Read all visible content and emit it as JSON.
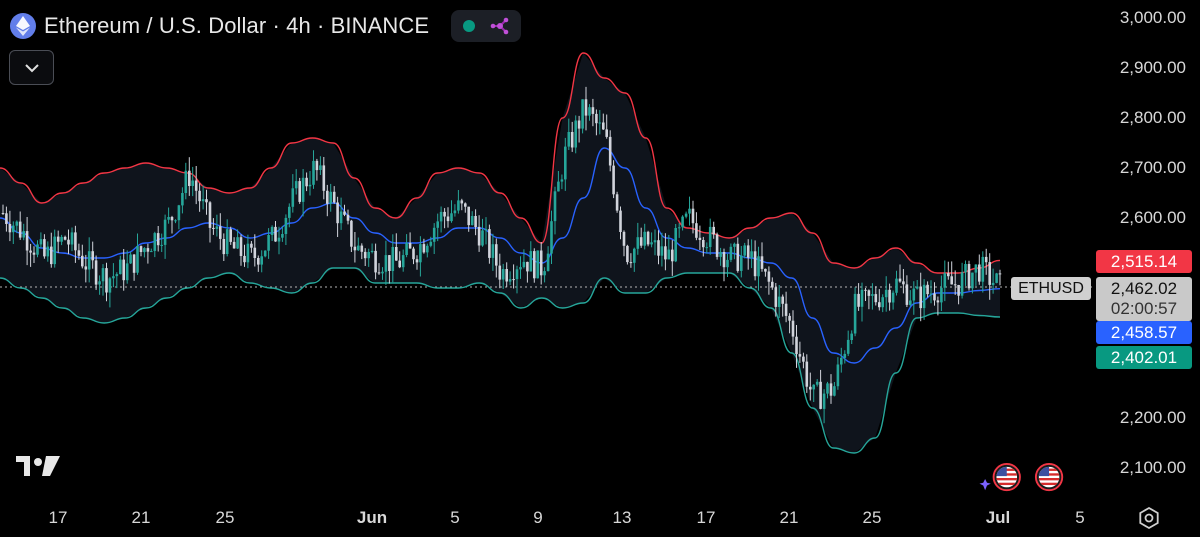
{
  "header": {
    "symbol_title": "Ethereum / U.S. Dollar · 4h · BINANCE",
    "logo_icon": "ethereum-icon",
    "status_icon": "market-open-dot",
    "indicator_icon": "ideas-network-icon",
    "collapse_icon": "chevron-down-icon"
  },
  "price_axis": {
    "labels": [
      "3,000.00",
      "2,900.00",
      "2,800.00",
      "2,700.00",
      "2,600.00",
      "2,200.00",
      "2,100.00"
    ]
  },
  "time_axis": {
    "labels": [
      "17",
      "21",
      "25",
      "Jun",
      "5",
      "9",
      "13",
      "17",
      "21",
      "25",
      "Jul",
      "5"
    ]
  },
  "price_tags": {
    "upper_band": "2,515.14",
    "last_price": "2,462.02",
    "countdown": "02:00:57",
    "basis": "2,458.57",
    "lower_band": "2,402.01",
    "symbol": "ETHUSD"
  },
  "colors": {
    "background": "#000000",
    "up_candle": "#26a69a",
    "down_candle": "#d1d4dc",
    "upper_band": "#f23645",
    "basis": "#2962ff",
    "lower_band": "#26a69a",
    "band_fill": "#0f141c"
  },
  "chart_data": {
    "type": "candlestick",
    "instrument": "Ethereum / U.S. Dollar",
    "timeframe": "4h",
    "exchange": "BINANCE",
    "ylim": [
      2080,
      3040
    ],
    "indicator": "Bollinger Bands",
    "close_series": [
      {
        "date": "May 14",
        "close": 2610
      },
      {
        "date": "May 15",
        "close": 2570
      },
      {
        "date": "May 16",
        "close": 2520
      },
      {
        "date": "May 17",
        "close": 2560
      },
      {
        "date": "May 18",
        "close": 2510
      },
      {
        "date": "May 19",
        "close": 2480
      },
      {
        "date": "May 20",
        "close": 2500
      },
      {
        "date": "May 21",
        "close": 2550
      },
      {
        "date": "May 22",
        "close": 2590
      },
      {
        "date": "May 23",
        "close": 2690
      },
      {
        "date": "May 24",
        "close": 2580
      },
      {
        "date": "May 25",
        "close": 2540
      },
      {
        "date": "May 26",
        "close": 2520
      },
      {
        "date": "May 27",
        "close": 2560
      },
      {
        "date": "May 28",
        "close": 2640
      },
      {
        "date": "May 29",
        "close": 2700
      },
      {
        "date": "May 30",
        "close": 2620
      },
      {
        "date": "May 31",
        "close": 2540
      },
      {
        "date": "Jun 1",
        "close": 2520
      },
      {
        "date": "Jun 2",
        "close": 2510
      },
      {
        "date": "Jun 3",
        "close": 2540
      },
      {
        "date": "Jun 4",
        "close": 2600
      },
      {
        "date": "Jun 5",
        "close": 2620
      },
      {
        "date": "Jun 6",
        "close": 2570
      },
      {
        "date": "Jun 7",
        "close": 2490
      },
      {
        "date": "Jun 8",
        "close": 2520
      },
      {
        "date": "Jun 9",
        "close": 2500
      },
      {
        "date": "Jun 10",
        "close": 2720
      },
      {
        "date": "Jun 11",
        "close": 2820
      },
      {
        "date": "Jun 12",
        "close": 2760
      },
      {
        "date": "Jun 13",
        "close": 2530
      },
      {
        "date": "Jun 14",
        "close": 2550
      },
      {
        "date": "Jun 15",
        "close": 2520
      },
      {
        "date": "Jun 16",
        "close": 2600
      },
      {
        "date": "Jun 17",
        "close": 2560
      },
      {
        "date": "Jun 18",
        "close": 2520
      },
      {
        "date": "Jun 19",
        "close": 2520
      },
      {
        "date": "Jun 20",
        "close": 2460
      },
      {
        "date": "Jun 21",
        "close": 2380
      },
      {
        "date": "Jun 22",
        "close": 2240
      },
      {
        "date": "Jun 23",
        "close": 2260
      },
      {
        "date": "Jun 24",
        "close": 2420
      },
      {
        "date": "Jun 25",
        "close": 2440
      },
      {
        "date": "Jun 26",
        "close": 2470
      },
      {
        "date": "Jun 27",
        "close": 2440
      },
      {
        "date": "Jun 28",
        "close": 2460
      },
      {
        "date": "Jun 29",
        "close": 2470
      },
      {
        "date": "Jun 30",
        "close": 2500
      },
      {
        "date": "Jul 1",
        "close": 2462
      }
    ],
    "upper_band": [
      2700,
      2670,
      2630,
      2650,
      2670,
      2690,
      2700,
      2710,
      2700,
      2690,
      2660,
      2650,
      2660,
      2700,
      2750,
      2760,
      2750,
      2680,
      2620,
      2600,
      2640,
      2690,
      2700,
      2690,
      2650,
      2600,
      2550,
      2800,
      2930,
      2880,
      2850,
      2760,
      2620,
      2580,
      2570,
      2560,
      2580,
      2600,
      2610,
      2570,
      2510,
      2500,
      2520,
      2540,
      2510,
      2490,
      2490,
      2500,
      2515.14
    ],
    "basis": [
      2600,
      2570,
      2540,
      2530,
      2520,
      2520,
      2530,
      2550,
      2560,
      2580,
      2590,
      2580,
      2560,
      2570,
      2590,
      2620,
      2630,
      2600,
      2570,
      2550,
      2550,
      2560,
      2580,
      2580,
      2560,
      2530,
      2510,
      2560,
      2640,
      2740,
      2700,
      2620,
      2560,
      2540,
      2530,
      2530,
      2520,
      2510,
      2480,
      2400,
      2330,
      2310,
      2340,
      2380,
      2430,
      2450,
      2450,
      2455,
      2458.57
    ],
    "lower_band": [
      2480,
      2460,
      2440,
      2420,
      2400,
      2390,
      2400,
      2420,
      2440,
      2460,
      2480,
      2490,
      2470,
      2460,
      2450,
      2470,
      2500,
      2500,
      2470,
      2470,
      2470,
      2460,
      2460,
      2470,
      2450,
      2420,
      2440,
      2420,
      2430,
      2480,
      2450,
      2450,
      2480,
      2490,
      2490,
      2490,
      2460,
      2420,
      2330,
      2220,
      2140,
      2130,
      2160,
      2290,
      2400,
      2410,
      2410,
      2405,
      2402.01
    ]
  }
}
